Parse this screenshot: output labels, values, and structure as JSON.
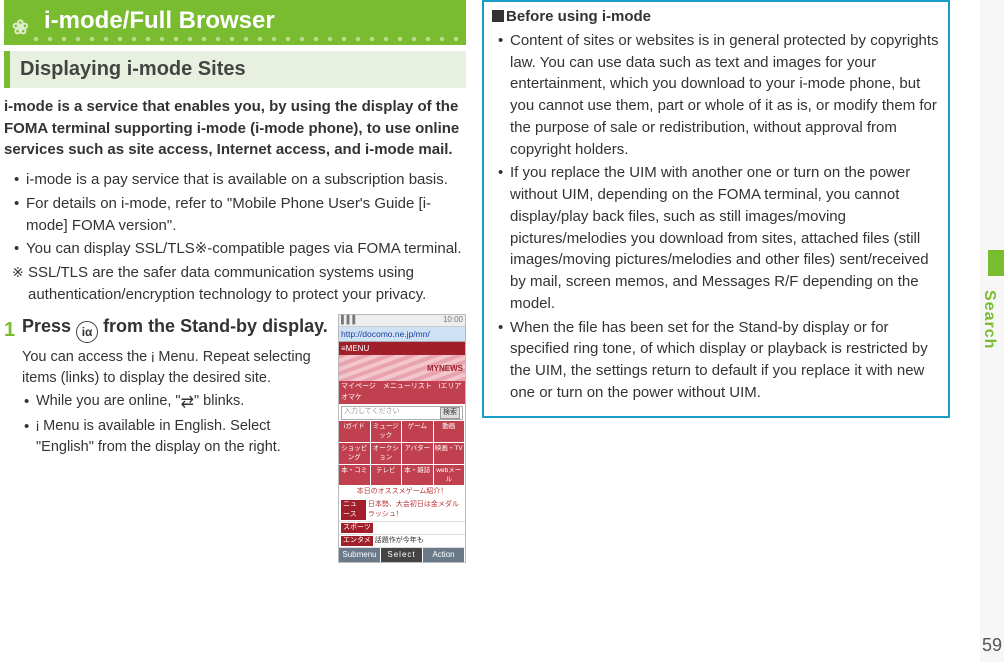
{
  "page_number": "59",
  "side_tab": "Search",
  "left": {
    "banner": "i-mode/Full Browser",
    "section": "Displaying i-mode Sites",
    "intro": "i-mode is a service that enables you, by using the display of the FOMA terminal supporting i-mode (i-mode phone), to use online services such as site access, Internet access, and i-mode mail.",
    "bullets": [
      "i-mode is a pay service that is available on a subscription basis.",
      "For details on i-mode, refer to \"Mobile Phone User's Guide [i-mode] FOMA version\".",
      "You can display SSL/TLS※-compatible pages via FOMA terminal."
    ],
    "note": "SSL/TLS are the safer data communication systems using authentication/encryption technology to protect your privacy.",
    "step": {
      "num": "1",
      "key_label": "iα",
      "title_before": "Press ",
      "title_after": " from the Stand-by display.",
      "desc1_before": "You can access the ",
      "desc1_icon": "i",
      "desc1_after": " Menu. Repeat selecting items (links) to display the desired site.",
      "sub1_before": "While you are online, \"",
      "sub1_icon": "⇄",
      "sub1_after": "\" blinks.",
      "sub2_icon": "i",
      "sub2_after": " Menu is available in English. Select \"English\" from the display on the right."
    }
  },
  "phone": {
    "url": "http://docomo.ne.jp/mn/",
    "menu": "≡MENU",
    "logo": "MYNEWS",
    "tabrow": "マイページ　メニューリスト　iエリア　オマケ",
    "input_placeholder": "入力してください",
    "input_btn": "検索",
    "grid1": [
      "iガイド",
      "ミュージック",
      "ゲーム",
      "動画"
    ],
    "grid2": [
      "ショッピング",
      "オークション",
      "アバター",
      "映画・TV"
    ],
    "grid3": [
      "本・コミ",
      "テレビ",
      "本・雑誌",
      "webメール"
    ],
    "promo": "本日のオススメゲーム紹介！",
    "news1_tag": "ニュース",
    "news1_txt": "日本勢、大会初日は金メダルラッシュ！",
    "news2_tag": "スポーツ",
    "news3_tag": "エンタメ",
    "news3_txt": "話題作が今年も",
    "sk_left": "Submenu",
    "sk_mid": "Select",
    "sk_right": "Action"
  },
  "right": {
    "heading": "Before using i-mode",
    "bullets": [
      "Content of sites or websites is in general protected by copyrights law. You can use data such as text and images for your entertainment, which you download to your i-mode phone, but you cannot use them, part or whole of it as is, or modify them for the purpose of sale or redistribution, without approval from copyright holders.",
      "If you replace the UIM with another one or turn on the power without UIM, depending on the FOMA terminal, you cannot display/play back files, such as still images/moving pictures/melodies you download from sites, attached files (still images/moving pictures/melodies and other files) sent/received by mail, screen memos, and Messages R/F depending on the model.",
      "When the file has been set for the Stand-by display or for specified ring tone, of which display or playback is restricted by the UIM, the settings return to default if you replace it with new one or turn on the power without UIM."
    ]
  }
}
